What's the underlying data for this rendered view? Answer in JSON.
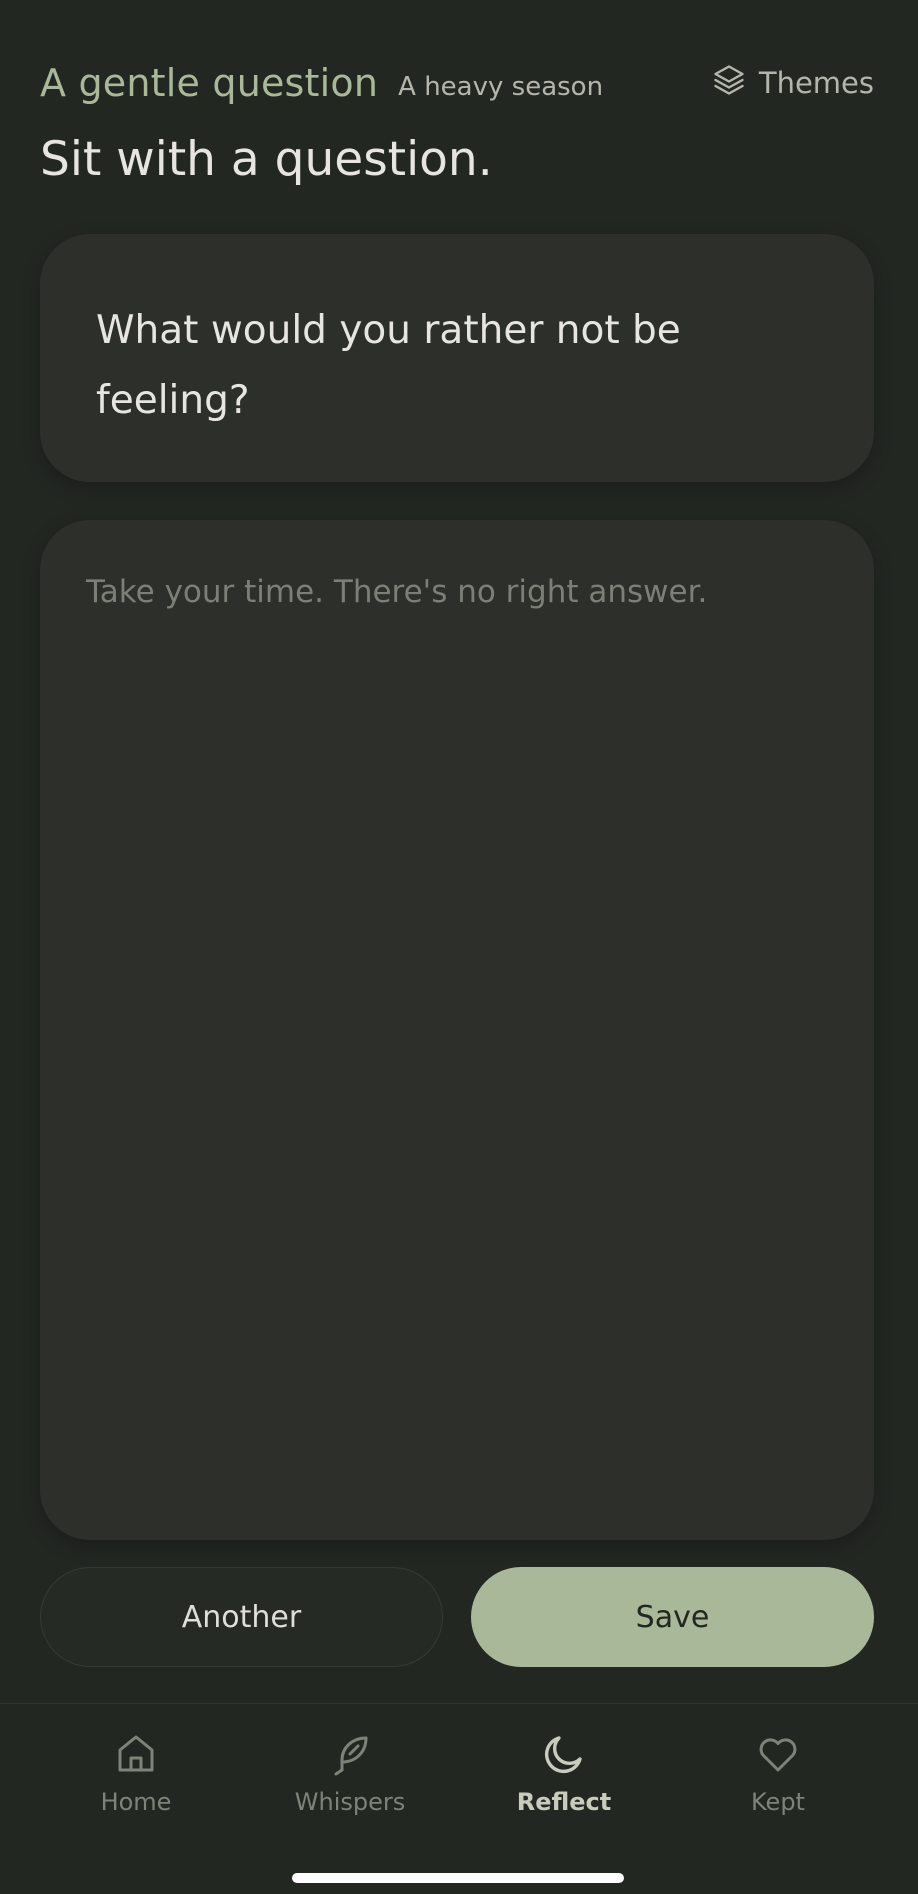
{
  "header": {
    "title": "A gentle question",
    "season": "A heavy season",
    "themes_label": "Themes"
  },
  "heading": "Sit with a question.",
  "question": {
    "text": "What would you rather not be feeling?"
  },
  "answer": {
    "value": "",
    "placeholder": "Take your time. There's no right answer."
  },
  "actions": {
    "another_label": "Another",
    "save_label": "Save"
  },
  "nav": {
    "items": [
      {
        "label": "Home",
        "icon": "home-icon",
        "active": false
      },
      {
        "label": "Whispers",
        "icon": "feather-icon",
        "active": false
      },
      {
        "label": "Reflect",
        "icon": "moon-icon",
        "active": true
      },
      {
        "label": "Kept",
        "icon": "heart-icon",
        "active": false
      }
    ]
  },
  "colors": {
    "background": "#232722",
    "card": "#2c2f2a",
    "accent": "#a9b898",
    "text": "#e6e5df",
    "muted": "#7e8378"
  }
}
